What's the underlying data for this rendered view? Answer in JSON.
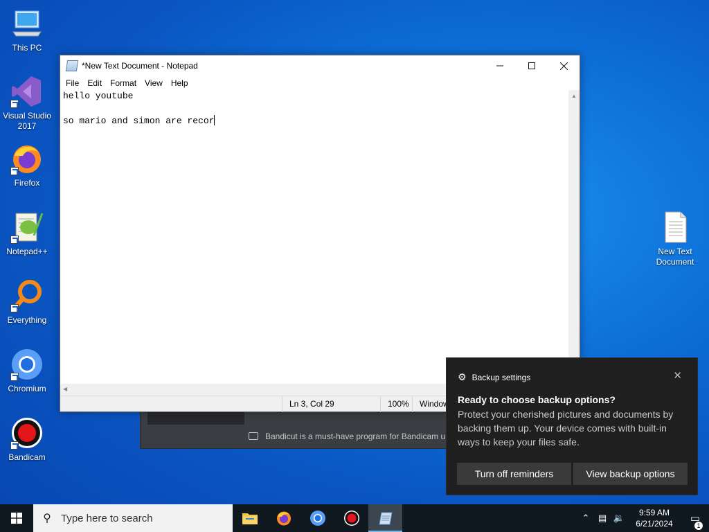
{
  "desktop": {
    "icons": [
      {
        "label": "This PC",
        "icon": "this-pc-icon"
      },
      {
        "label": "Visual Studio 2017",
        "icon": "visual-studio-icon"
      },
      {
        "label": "Firefox",
        "icon": "firefox-icon"
      },
      {
        "label": "Notepad++",
        "icon": "notepad-plus-plus-icon"
      },
      {
        "label": "Everything",
        "icon": "everything-icon"
      },
      {
        "label": "Chromium",
        "icon": "chromium-icon"
      },
      {
        "label": "Bandicam",
        "icon": "bandicam-icon"
      },
      {
        "label": "New Text Document",
        "icon": "text-document-icon"
      }
    ]
  },
  "bandicam": {
    "message": "Bandicut is a must-have program for Bandicam u"
  },
  "notepad": {
    "title": "*New Text Document - Notepad",
    "menu": [
      "File",
      "Edit",
      "Format",
      "View",
      "Help"
    ],
    "content_lines": [
      "hello youtube",
      "",
      "so mario and simon are recor"
    ],
    "status": {
      "position": "Ln 3, Col 29",
      "zoom": "100%",
      "line_ending": "Window"
    }
  },
  "toast": {
    "header": "Backup settings",
    "title": "Ready to choose backup options?",
    "body": "Protect your cherished pictures and documents by backing them up. Your device comes with built-in ways to keep your files safe.",
    "button_left": "Turn off reminders",
    "button_right": "View backup options"
  },
  "taskbar": {
    "search_placeholder": "Type here to search",
    "apps": [
      "file-explorer-icon",
      "firefox-icon",
      "chromium-icon",
      "bandicam-icon",
      "notepad-icon"
    ],
    "time": "9:59 AM",
    "date": "6/21/2024",
    "notification_count": "1"
  },
  "colors": {
    "desktop_blue": "#0d6fd8",
    "taskbar": "#101820",
    "toast_bg": "#1f1f1f",
    "toast_button": "#3a3a3a"
  }
}
